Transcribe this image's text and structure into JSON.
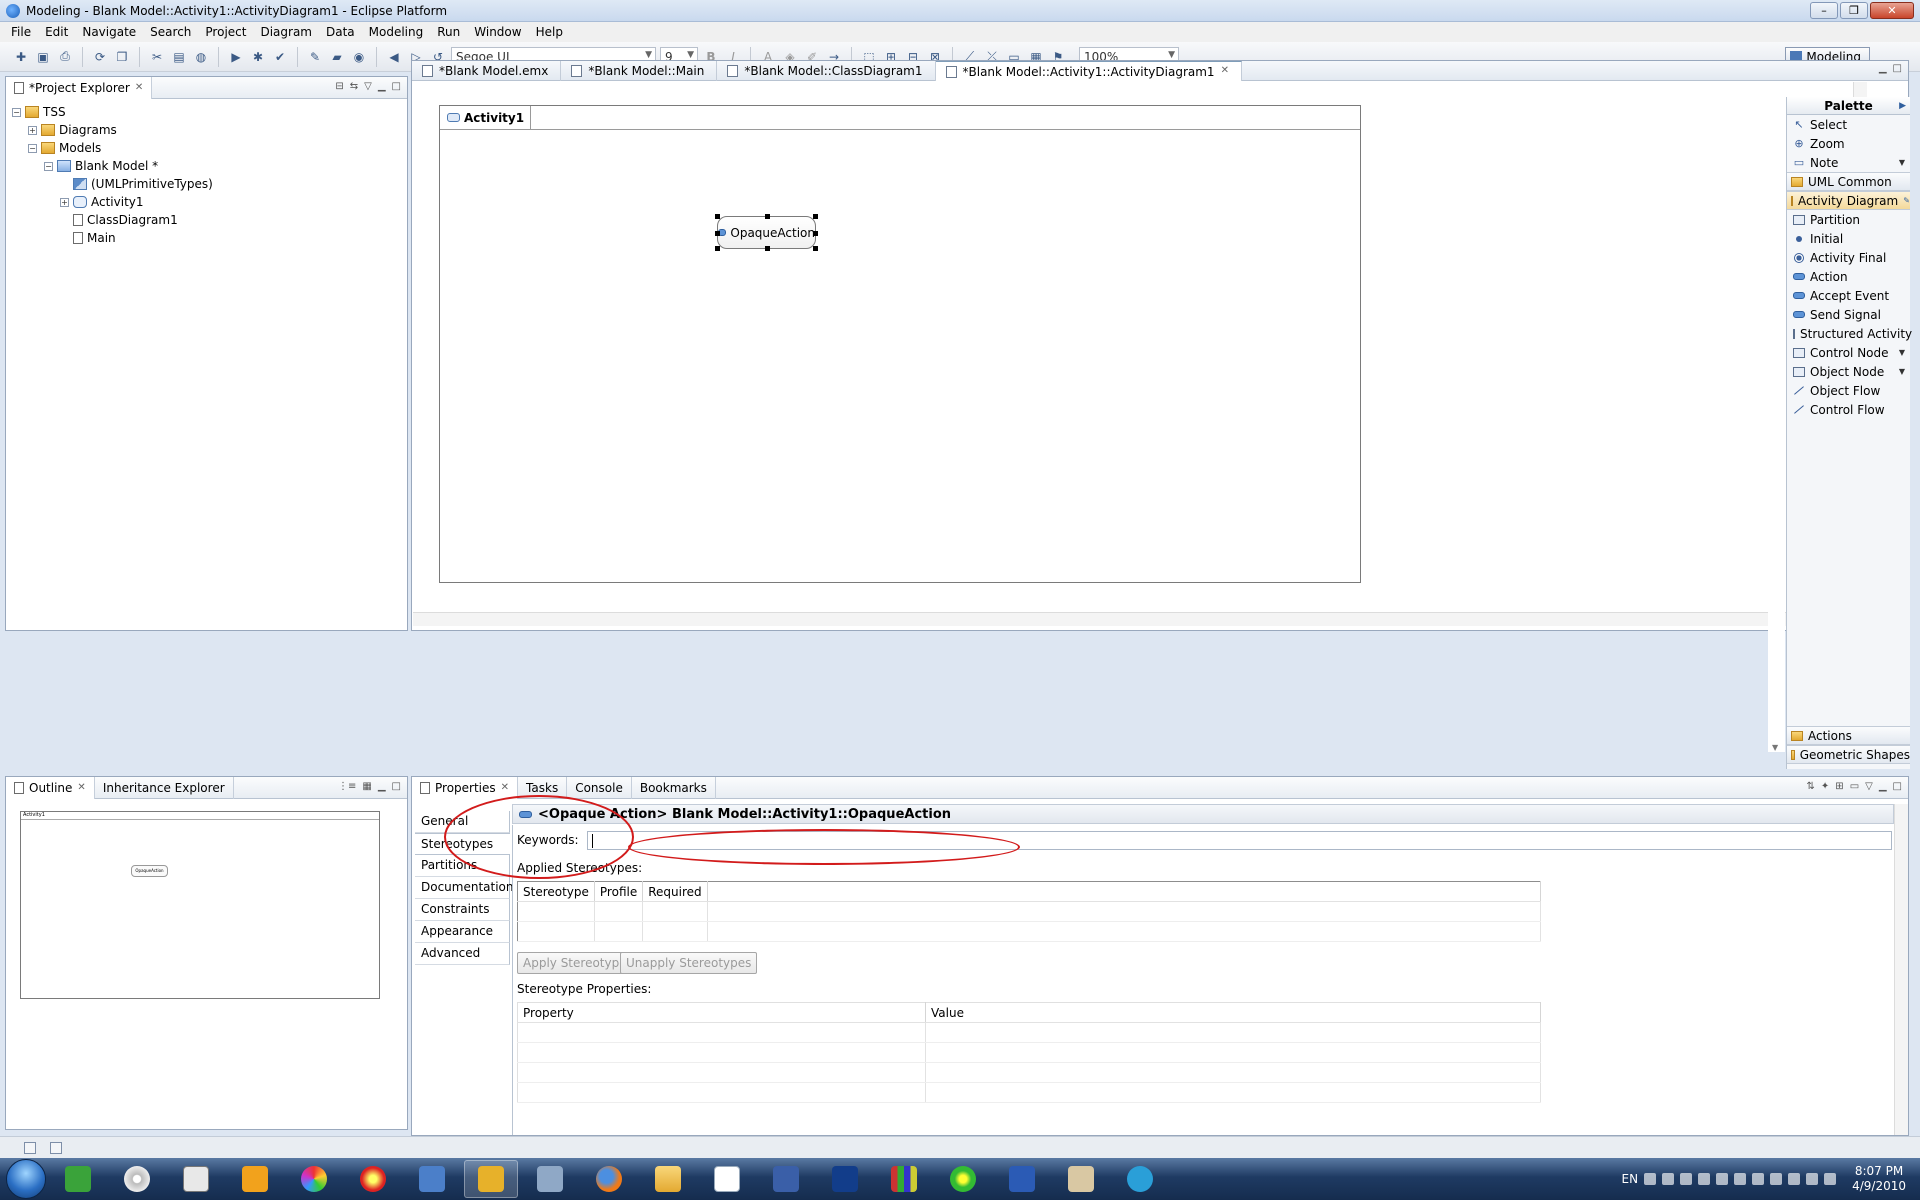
{
  "window": {
    "title": "Modeling - Blank Model::Activity1::ActivityDiagram1 - Eclipse Platform",
    "minimize": "–",
    "maximize": "❐",
    "close": "✕"
  },
  "menu": [
    "File",
    "Edit",
    "Navigate",
    "Search",
    "Project",
    "Diagram",
    "Data",
    "Modeling",
    "Run",
    "Window",
    "Help"
  ],
  "toolbar": {
    "font_name": "Segoe UI",
    "font_size": "9",
    "bold": "B",
    "italic": "I",
    "zoom": "100%",
    "perspective": "Modeling"
  },
  "project_explorer": {
    "title": "*Project Explorer",
    "tree": [
      {
        "label": "TSS",
        "indent": 0,
        "expander": "−",
        "icon": "folder"
      },
      {
        "label": "Diagrams",
        "indent": 1,
        "expander": "+",
        "icon": "folder"
      },
      {
        "label": "Models",
        "indent": 1,
        "expander": "−",
        "icon": "folder"
      },
      {
        "label": "Blank Model *",
        "indent": 2,
        "expander": "−",
        "icon": "model"
      },
      {
        "label": "(UMLPrimitiveTypes)",
        "indent": 3,
        "expander": "",
        "icon": "prim"
      },
      {
        "label": "Activity1",
        "indent": 3,
        "expander": "+",
        "icon": "activity"
      },
      {
        "label": "ClassDiagram1",
        "indent": 3,
        "expander": "",
        "icon": "doc"
      },
      {
        "label": "Main",
        "indent": 3,
        "expander": "",
        "icon": "doc"
      }
    ]
  },
  "editor": {
    "tabs": [
      {
        "label": "*Blank Model.emx",
        "active": false
      },
      {
        "label": "*Blank Model::Main",
        "active": false
      },
      {
        "label": "*Blank Model::ClassDiagram1",
        "active": false
      },
      {
        "label": "*Blank Model::Activity1::ActivityDiagram1",
        "active": true
      }
    ],
    "activity_title": "Activity1",
    "node_label": "OpaqueAction"
  },
  "palette": {
    "title": "Palette",
    "items": [
      {
        "label": "Select",
        "kind": "item",
        "icon": "cursor"
      },
      {
        "label": "Zoom",
        "kind": "item",
        "icon": "zoom"
      },
      {
        "label": "Note",
        "kind": "item",
        "icon": "note",
        "dropdown": true
      },
      {
        "label": "UML Common",
        "kind": "drawer",
        "open": false
      },
      {
        "label": "Activity Diagram",
        "kind": "drawer",
        "open": true
      },
      {
        "label": "Partition",
        "kind": "item",
        "icon": "box"
      },
      {
        "label": "Initial",
        "kind": "item",
        "icon": "dot"
      },
      {
        "label": "Activity Final",
        "kind": "item",
        "icon": "final"
      },
      {
        "label": "Action",
        "kind": "item",
        "icon": "action"
      },
      {
        "label": "Accept Event",
        "kind": "item",
        "icon": "action"
      },
      {
        "label": "Send Signal",
        "kind": "item",
        "icon": "action"
      },
      {
        "label": "Structured Activity",
        "kind": "item",
        "icon": "box"
      },
      {
        "label": "Control Node",
        "kind": "item",
        "icon": "box",
        "dropdown": true
      },
      {
        "label": "Object Node",
        "kind": "item",
        "icon": "box",
        "dropdown": true
      },
      {
        "label": "Object Flow",
        "kind": "item",
        "icon": "line"
      },
      {
        "label": "Control Flow",
        "kind": "item",
        "icon": "line"
      }
    ],
    "bottom_drawers": [
      "Actions",
      "Geometric Shapes"
    ]
  },
  "outline": {
    "tabs": [
      "Outline",
      "Inheritance Explorer"
    ],
    "mini_title": "Activity1",
    "mini_node": "OpaqueAction"
  },
  "properties": {
    "tabs": [
      "Properties",
      "Tasks",
      "Console",
      "Bookmarks"
    ],
    "header": "<Opaque Action> Blank Model::Activity1::OpaqueAction",
    "side_tabs": [
      "General",
      "Stereotypes",
      "Partitions",
      "Documentation",
      "Constraints",
      "Appearance",
      "Advanced"
    ],
    "active_side_tab": "Stereotypes",
    "keywords_label": "Keywords:",
    "keywords_value": "",
    "applied_label": "Applied Stereotypes:",
    "stereo_columns": [
      "Stereotype",
      "Profile",
      "Required"
    ],
    "apply_btn": "Apply Stereotypes...",
    "unapply_btn": "Unapply Stereotypes",
    "props_label": "Stereotype Properties:",
    "prop_columns": [
      "Property",
      "Value"
    ]
  },
  "tray": {
    "lang": "EN",
    "time": "8:07 PM",
    "date": "4/9/2010"
  },
  "colors": {
    "annotation": "#d21b1b",
    "selection_handle": "#000000"
  }
}
